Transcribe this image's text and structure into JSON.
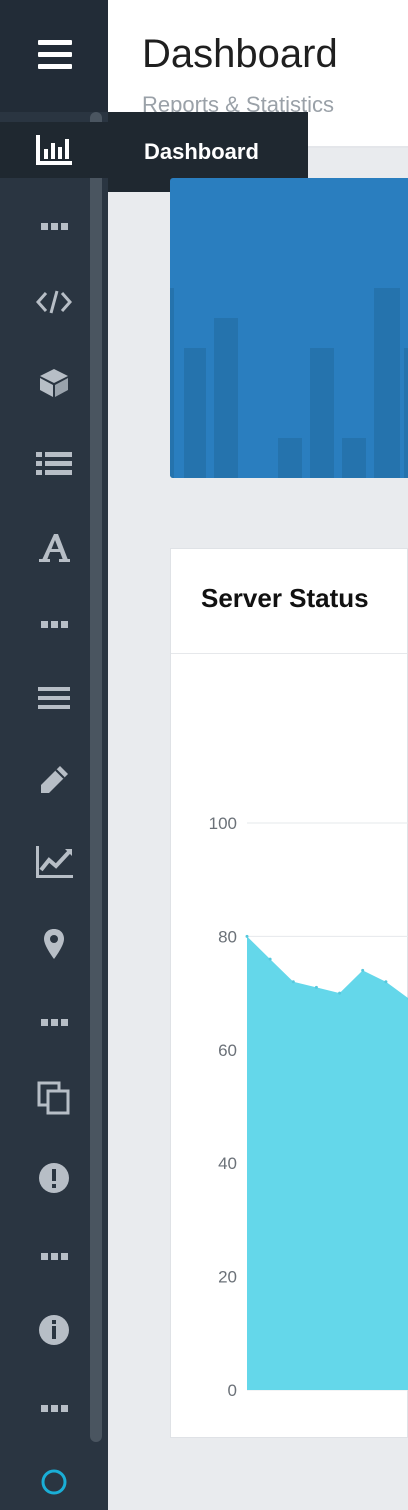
{
  "header": {
    "title": "Dashboard",
    "subtitle": "Reports & Statistics"
  },
  "sidebar": {
    "tooltip": "Dashboard",
    "items": [
      {
        "icon": "menu-icon"
      },
      {
        "icon": "bar-chart-icon",
        "active": true
      },
      {
        "icon": "more-dots-icon"
      },
      {
        "icon": "code-icon"
      },
      {
        "icon": "cube-icon"
      },
      {
        "icon": "list-icon"
      },
      {
        "icon": "font-icon"
      },
      {
        "icon": "more-dots-icon"
      },
      {
        "icon": "menu-lines-icon"
      },
      {
        "icon": "pencil-icon"
      },
      {
        "icon": "line-chart-icon"
      },
      {
        "icon": "map-marker-icon"
      },
      {
        "icon": "more-dots-icon"
      },
      {
        "icon": "copy-icon"
      },
      {
        "icon": "exclamation-icon"
      },
      {
        "icon": "more-dots-icon"
      },
      {
        "icon": "info-icon"
      },
      {
        "icon": "more-dots-icon"
      },
      {
        "icon": "circle-icon"
      }
    ]
  },
  "colors": {
    "sidebar_bg": "#2a3541",
    "accent_blue": "#2a7ebf",
    "area_fill": "#64d7ea",
    "status_circle": "#1aaed6"
  },
  "server_status": {
    "title": "Server Status",
    "chart_data": {
      "type": "area",
      "title": "Server Status",
      "ylim": [
        0,
        100
      ],
      "y_ticks": [
        "0",
        "20",
        "40",
        "60",
        "80",
        "100"
      ],
      "y": [
        80,
        76,
        72,
        71,
        70,
        74,
        72,
        69
      ],
      "grid": true
    }
  }
}
